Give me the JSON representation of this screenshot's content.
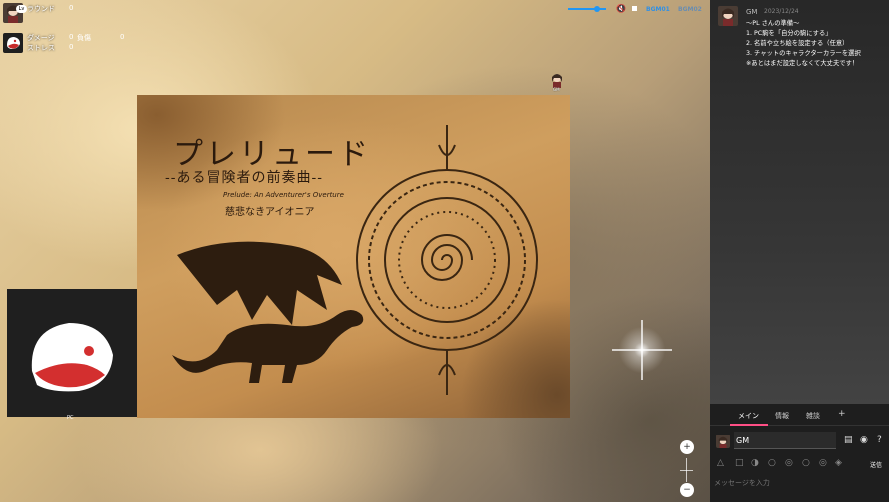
{
  "status_top": {
    "level_badge": "Lv",
    "round_label": "ラウンド",
    "round_value": "0"
  },
  "status_bottom": {
    "damage_label": "ダメージ",
    "damage_value": "0",
    "injury_label": "負傷",
    "injury_value": "0",
    "stress_label": "ストレス",
    "stress_value": "0"
  },
  "audio": {
    "volume_percent": 75,
    "bgm1_label": "BGM01",
    "bgm2_label": "BGM02"
  },
  "scenario_card": {
    "title": "プレリュード",
    "subtitle": "--ある冒険者の前奏曲--",
    "english_subtitle": "Prelude: An Adventurer's Overture",
    "author": "慈悲なきアイオニア"
  },
  "tokens": {
    "gm_label": "GM",
    "pc_label": "PC"
  },
  "zoom": {
    "zoom_in": "+",
    "zoom_out": "−"
  },
  "chat": {
    "messages": [
      {
        "name": "GM",
        "time": "2023/12/24",
        "lines": [
          "〜PL さんの準備〜",
          "1. PC駒を「自分の駒にする」",
          "2. 名前や立ち絵を設定する（任意）",
          "3. チャットのキャラクターカラーを選択",
          "※あとはまだ設定しなくて大丈夫です！"
        ]
      }
    ],
    "tabs": [
      "メイン",
      "情報",
      "雑談",
      "+"
    ],
    "active_tab": "メイン",
    "speaker_name": "GM",
    "send_label": "送信",
    "input_placeholder": "メッセージを入力"
  },
  "colors": {
    "accent": "#2196f3",
    "tab_underline": "#ff4f86",
    "panel_bg": "#272727",
    "pc_red": "#d32f2f"
  }
}
